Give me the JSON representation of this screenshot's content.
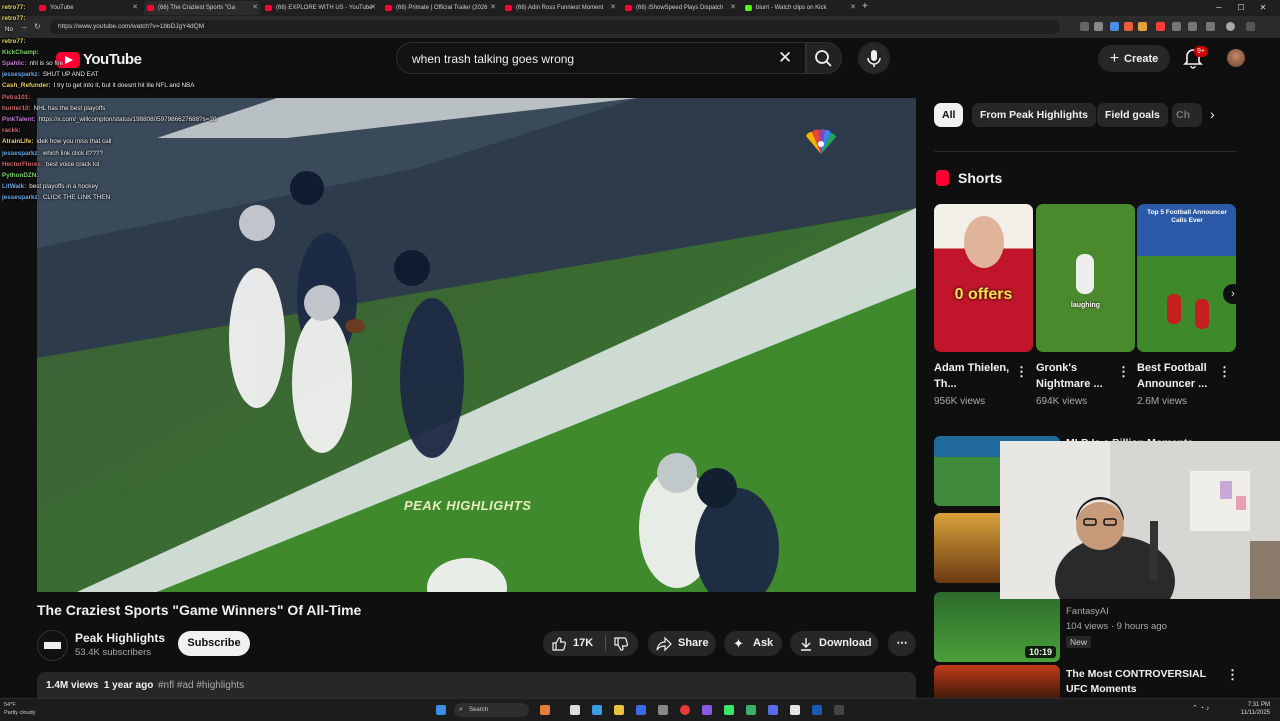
{
  "browser": {
    "tabs": [
      {
        "label": "YouTube",
        "active": false
      },
      {
        "label": "(66) The Craziest Sports \"Ga",
        "active": true
      },
      {
        "label": "(66) EXPLORE WITH US - YouTube",
        "active": false
      },
      {
        "label": "(66) Primate | Official Trailer (2026",
        "active": false
      },
      {
        "label": "(66) Adin Ross Funniest Moment",
        "active": false
      },
      {
        "label": "(66) iShowSpeed Plays Dispatch",
        "active": false
      },
      {
        "label": "blurri - Watch clips on Kick",
        "active": false
      }
    ],
    "url": "https://www.youtube.com/watch?v=1bbDJgY4dQM"
  },
  "header": {
    "logo_text": "YouTube",
    "search": {
      "value": "when trash talking goes wrong",
      "placeholder": "Search"
    },
    "create_label": "Create",
    "notification_badge": "9+"
  },
  "chat": [
    {
      "user": "retro77:",
      "msg": "",
      "color": "#e8d26a"
    },
    {
      "user": "retro77:",
      "msg": "",
      "color": "#e8d26a"
    },
    {
      "user": "",
      "msg": "No",
      "color": "#ffffff"
    },
    {
      "user": "retro77:",
      "msg": "",
      "color": "#e8d26a"
    },
    {
      "user": "KickChamp:",
      "msg": "",
      "color": "#7fd16b"
    },
    {
      "user": "Spahlic:",
      "msg": "nhl is so fire",
      "color": "#c87ad6"
    },
    {
      "user": "jessesparkz:",
      "msg": "SHUT UP AND EAT",
      "color": "#6aa8e8"
    },
    {
      "user": "Cash_Refunder:",
      "msg": "I try to get into it, but it doesnt hit lile NFL and NBA",
      "color": "#e8d26a"
    },
    {
      "user": "Petra101:",
      "msg": "",
      "color": "#d06a6a"
    },
    {
      "user": "hunter10:",
      "msg": "NHL has the best playoffs",
      "color": "#d06a6a"
    },
    {
      "user": "PinkTalent:",
      "msg": "https://x.com/_willcompton/status/1988080597986627688?s=20",
      "color": "#c87ad6"
    },
    {
      "user": "rackk:",
      "msg": "",
      "color": "#d06a6a"
    },
    {
      "user": "AtrainLife:",
      "msg": "idek how you miss that call",
      "color": "#e8d26a"
    },
    {
      "user": "jessesparkz:",
      "msg": "which link click it????",
      "color": "#6aa8e8"
    },
    {
      "user": "HectorFlores:",
      "msg": "best voice crack lol",
      "color": "#d06a6a"
    },
    {
      "user": "PythonDZN:",
      "msg": "",
      "color": "#7fd16b"
    },
    {
      "user": "LitWalk:",
      "msg": "best playoffs in a hockey",
      "color": "#6aa8e8"
    },
    {
      "user": "jessesparkz:",
      "msg": "CLICK THE LINK THEN",
      "color": "#6aa8e8"
    }
  ],
  "video": {
    "watermark": "PEAK HIGHLIGHTS",
    "title": "The Craziest Sports \"Game Winners\" Of All-Time",
    "channel": "Peak Highlights",
    "subscribers": "53.4K subscribers",
    "subscribe_label": "Subscribe",
    "likes": "17K",
    "share_label": "Share",
    "ask_label": "Ask",
    "download_label": "Download",
    "views": "1.4M views",
    "age": "1 year ago",
    "tags": "#nfl #ad #highlights"
  },
  "chips": [
    "All",
    "From Peak Highlights",
    "Field goals",
    "Ch"
  ],
  "shorts": {
    "heading": "Shorts",
    "items": [
      {
        "title": "Adam Thielen, Th...",
        "views": "956K views",
        "overlay": "0 offers"
      },
      {
        "title": "Gronk's Nightmare ...",
        "views": "694K views",
        "overlay": "laughing"
      },
      {
        "title": "Best Football Announcer ...",
        "views": "2.6M views",
        "overlay": "Top 5 Football Announcer Calls Ever"
      }
    ]
  },
  "recommendations": [
    {
      "title": "MLB Is a Billion Moments",
      "meta": ""
    },
    {
      "title": "",
      "meta": ""
    },
    {
      "title": "",
      "channel": "FantasyAI",
      "meta": "104 views · 9 hours ago",
      "badge": "New",
      "duration": "10:19"
    },
    {
      "title": "The Most CONTROVERSIAL UFC Moments",
      "meta": ""
    }
  ],
  "taskbar": {
    "weather_temp": "54°F",
    "weather_desc": "Partly cloudy",
    "search_label": "Search",
    "time": "7:31 PM",
    "date": "11/11/2025"
  },
  "colors": {
    "accent": "#ff0033",
    "bg": "#0f0f0f",
    "chip": "#272727"
  }
}
